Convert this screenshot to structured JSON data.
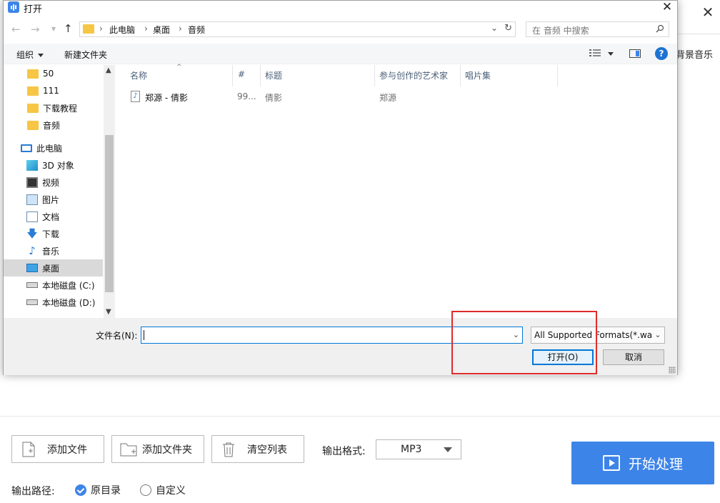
{
  "app": {
    "close_glyph": "✕",
    "bg_music_label": "背景音乐",
    "buttons": {
      "add_file": "添加文件",
      "add_folder": "添加文件夹",
      "clear_list": "清空列表"
    },
    "output_format": {
      "label": "输出格式:",
      "value": "MP3"
    },
    "start_button": "开始处理",
    "output_path": {
      "label": "输出路径:",
      "options": [
        "原目录",
        "自定义"
      ],
      "selected": "原目录"
    },
    "accent_color": "#3d84e8"
  },
  "dialog": {
    "title": "打开",
    "close_glyph": "✕",
    "address": {
      "segments": [
        "此电脑",
        "桌面",
        "音频"
      ],
      "separator": "›"
    },
    "search_placeholder": "在 音频 中搜索",
    "toolbar": {
      "organize": "组织",
      "new_folder": "新建文件夹"
    },
    "sidebar": [
      {
        "label": "50",
        "icon": "folder-icon"
      },
      {
        "label": "111",
        "icon": "folder-icon"
      },
      {
        "label": "下载教程",
        "icon": "folder-icon"
      },
      {
        "label": "音频",
        "icon": "folder-icon"
      },
      {
        "label": "此电脑",
        "icon": "computer-icon"
      },
      {
        "label": "3D 对象",
        "icon": "3d-objects-icon"
      },
      {
        "label": "视频",
        "icon": "video-icon"
      },
      {
        "label": "图片",
        "icon": "pictures-icon"
      },
      {
        "label": "文档",
        "icon": "documents-icon"
      },
      {
        "label": "下载",
        "icon": "downloads-icon"
      },
      {
        "label": "音乐",
        "icon": "music-icon"
      },
      {
        "label": "桌面",
        "icon": "desktop-icon",
        "selected": true
      },
      {
        "label": "本地磁盘 (C:)",
        "icon": "drive-icon"
      },
      {
        "label": "本地磁盘 (D:)",
        "icon": "drive-icon"
      }
    ],
    "columns": [
      "名称",
      "#",
      "标题",
      "参与创作的艺术家",
      "唱片集"
    ],
    "files": [
      {
        "name": "郑源 - 倩影",
        "number": "99...",
        "title": "倩影",
        "artist": "郑源",
        "album": ""
      }
    ],
    "filename_label": "文件名(N):",
    "filename_value": "",
    "filetype": "All Supported Formats(*.wav",
    "open_button": "打开(O)",
    "cancel_button": "取消",
    "highlight_color": "#e02b2b"
  }
}
